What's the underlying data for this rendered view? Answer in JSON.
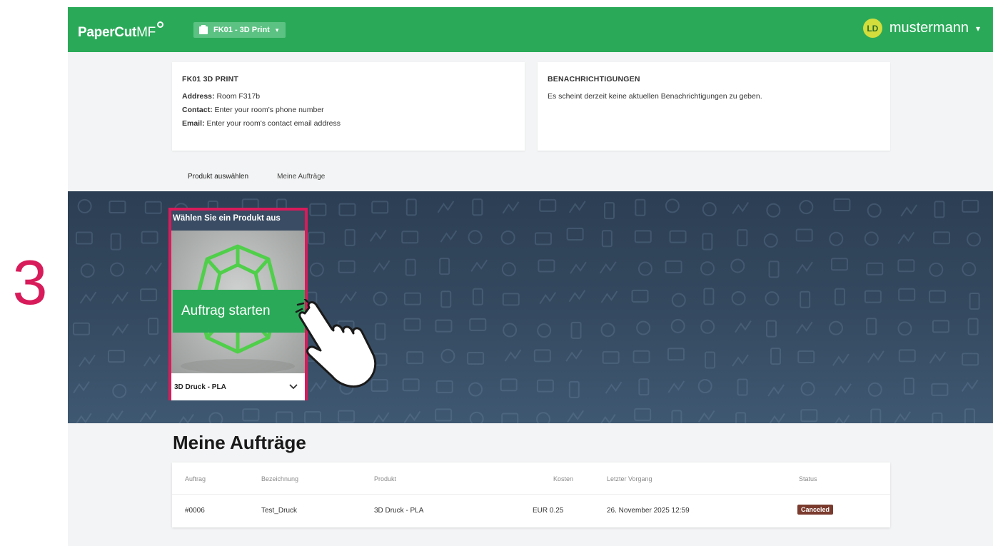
{
  "step": {
    "number": "3"
  },
  "header": {
    "logo_primary": "PaperCut",
    "logo_secondary": "MF",
    "device_label": "FK01 - 3D Print",
    "user_initials": "LD",
    "username": "mustermann",
    "accent_color": "#2aaa58"
  },
  "info_card": {
    "title": "FK01 3D PRINT",
    "address_label": "Address:",
    "address_value": "Room F317b",
    "contact_label": "Contact:",
    "contact_value": "Enter your room's phone number",
    "email_label": "Email:",
    "email_value": "Enter your room's contact email address"
  },
  "notifications": {
    "title": "BENACHRICHTIGUNGEN",
    "message": "Es scheint derzeit keine aktuellen Benachrichtigungen zu geben."
  },
  "tabs": [
    {
      "label": "Produkt auswählen",
      "active": true
    },
    {
      "label": "Meine Aufträge",
      "active": false
    }
  ],
  "product": {
    "heading": "Wählen Sie ein Produkt aus",
    "start_label": "Auftrag starten",
    "selected": "3D Druck - PLA",
    "highlight_color": "#d81b5a"
  },
  "jobs": {
    "title": "Meine Aufträge",
    "columns": {
      "job": "Auftrag",
      "name": "Bezeichnung",
      "product": "Produkt",
      "cost": "Kosten",
      "last": "Letzter Vorgang",
      "status": "Status"
    },
    "rows": [
      {
        "job": "#0006",
        "name": "Test_Druck",
        "product": "3D Druck - PLA",
        "cost": "EUR 0.25",
        "last": "26. November 2025 12:59",
        "status": "Canceled"
      }
    ]
  }
}
